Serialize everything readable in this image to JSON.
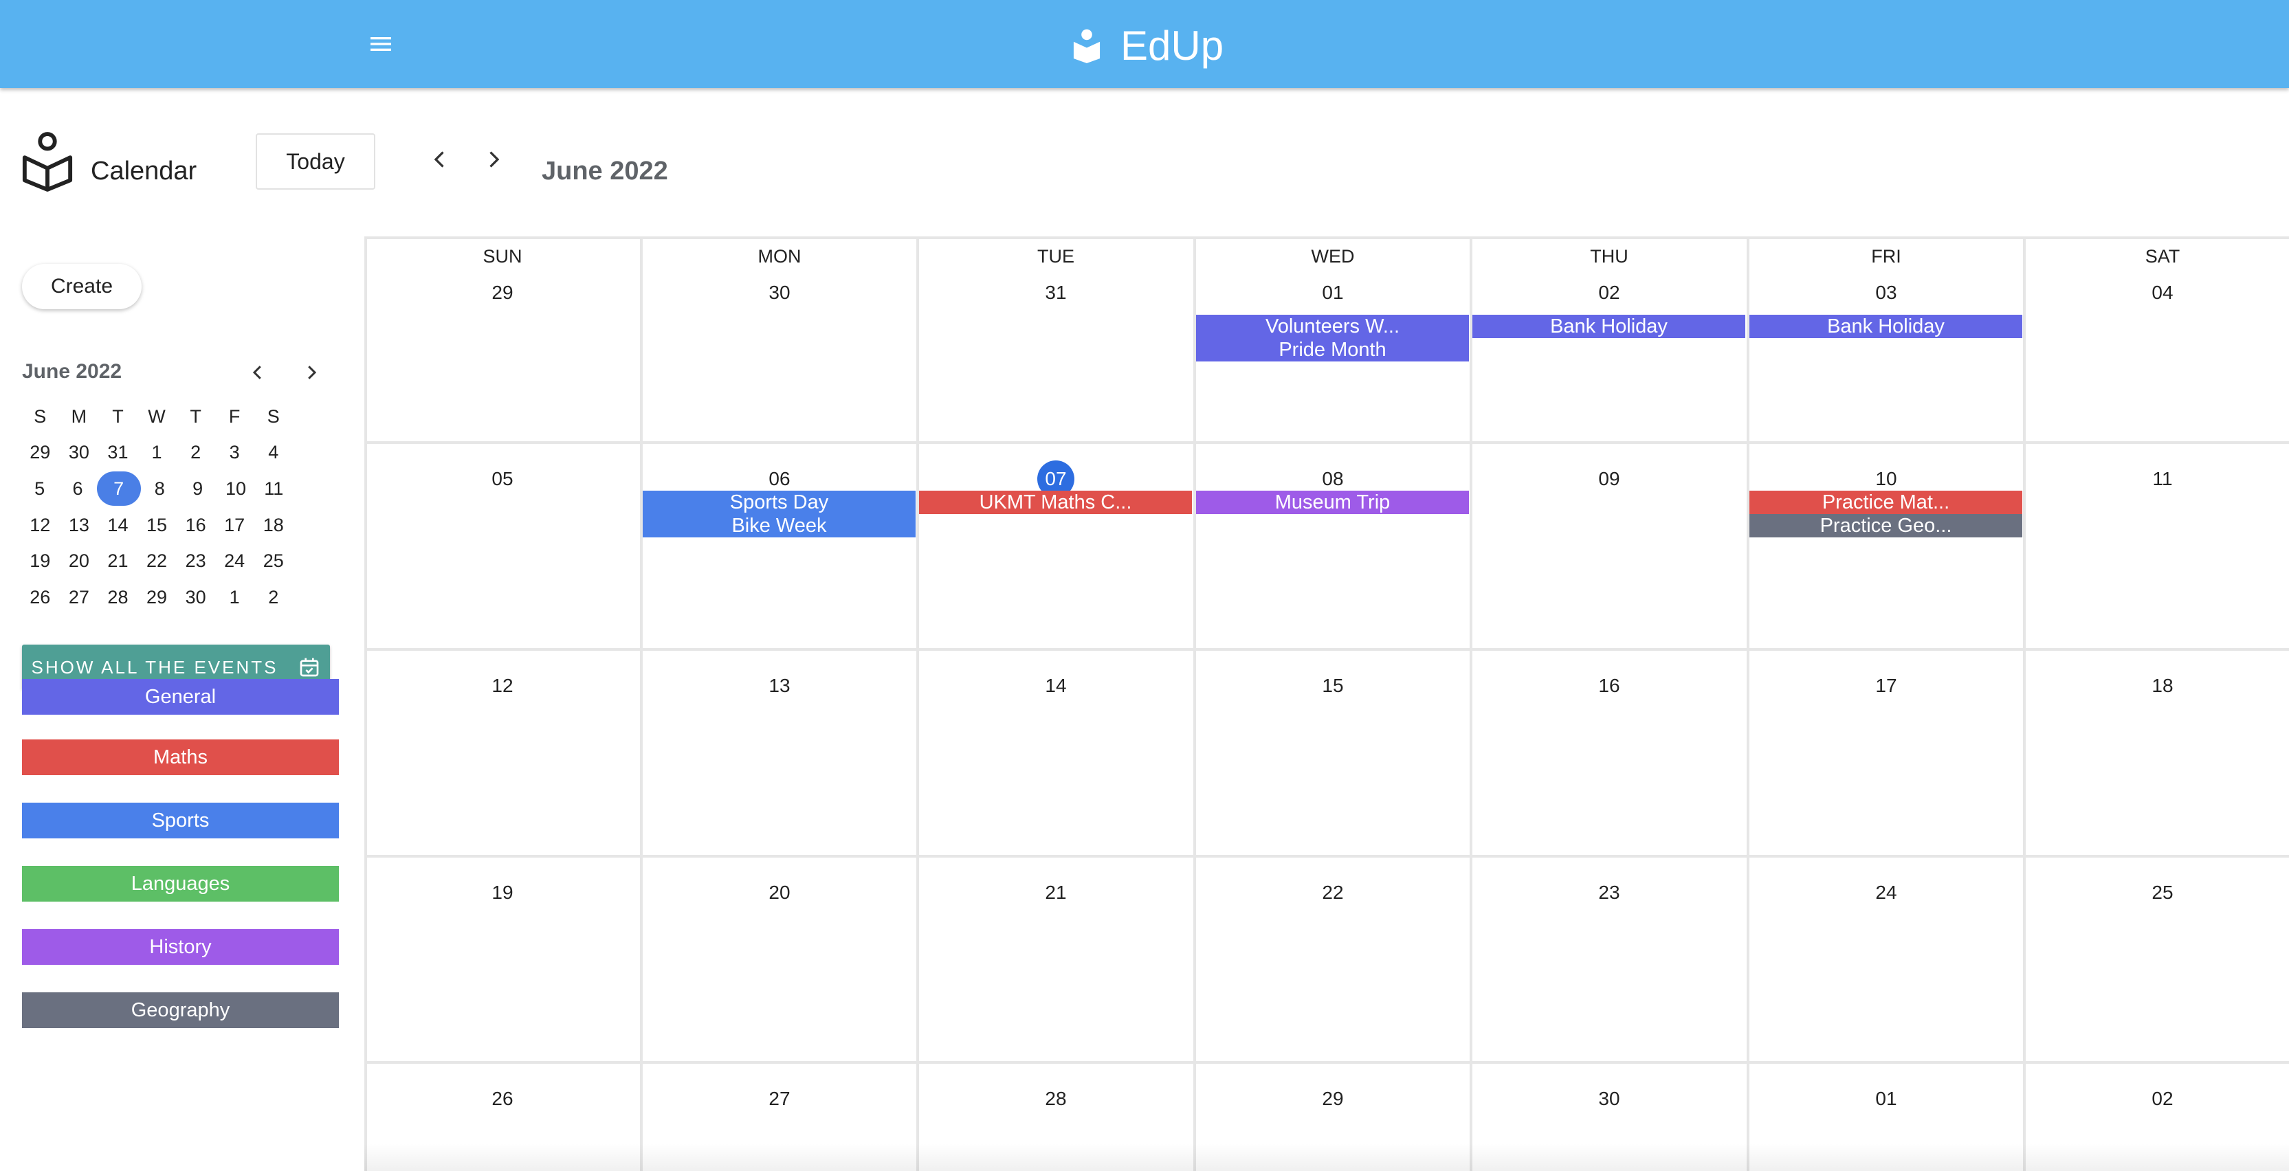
{
  "app": {
    "name": "EdUp"
  },
  "header": {
    "title": "Calendar",
    "today_label": "Today",
    "month_label": "June 2022"
  },
  "sidebar": {
    "create_label": "Create",
    "mini_calendar": {
      "title": "June 2022",
      "weekdays": [
        "S",
        "M",
        "T",
        "W",
        "T",
        "F",
        "S"
      ],
      "weeks": [
        [
          "29",
          "30",
          "31",
          "1",
          "2",
          "3",
          "4"
        ],
        [
          "5",
          "6",
          "7",
          "8",
          "9",
          "10",
          "11"
        ],
        [
          "12",
          "13",
          "14",
          "15",
          "16",
          "17",
          "18"
        ],
        [
          "19",
          "20",
          "21",
          "22",
          "23",
          "24",
          "25"
        ],
        [
          "26",
          "27",
          "28",
          "29",
          "30",
          "1",
          "2"
        ]
      ],
      "selected": "7"
    },
    "show_all_label": "SHOW ALL THE EVENTS",
    "categories": [
      {
        "label": "General",
        "color": "#6366e6"
      },
      {
        "label": "Maths",
        "color": "#e0504b"
      },
      {
        "label": "Sports",
        "color": "#4a80ea"
      },
      {
        "label": "Languages",
        "color": "#5dbf66"
      },
      {
        "label": "History",
        "color": "#9e5be8"
      },
      {
        "label": "Geography",
        "color": "#6a7080"
      }
    ]
  },
  "calendar": {
    "weekdays": [
      "SUN",
      "MON",
      "TUE",
      "WED",
      "THU",
      "FRI",
      "SAT"
    ],
    "weeks": [
      [
        "29",
        "30",
        "31",
        "01",
        "02",
        "03",
        "04"
      ],
      [
        "05",
        "06",
        "07",
        "08",
        "09",
        "10",
        "11"
      ],
      [
        "12",
        "13",
        "14",
        "15",
        "16",
        "17",
        "18"
      ],
      [
        "19",
        "20",
        "21",
        "22",
        "23",
        "24",
        "25"
      ],
      [
        "26",
        "27",
        "28",
        "29",
        "30",
        "01",
        "02"
      ]
    ],
    "today": "07",
    "events": [
      {
        "week": 0,
        "day": 3,
        "slot": 0,
        "label": "Volunteers W...",
        "color": "#6366e6"
      },
      {
        "week": 0,
        "day": 3,
        "slot": 1,
        "label": "Pride Month",
        "color": "#6366e6"
      },
      {
        "week": 0,
        "day": 4,
        "slot": 0,
        "label": "Bank Holiday",
        "color": "#6366e6"
      },
      {
        "week": 0,
        "day": 5,
        "slot": 0,
        "label": "Bank Holiday",
        "color": "#6366e6"
      },
      {
        "week": 1,
        "day": 1,
        "slot": 0,
        "label": "Sports Day",
        "color": "#4a80ea"
      },
      {
        "week": 1,
        "day": 1,
        "slot": 1,
        "label": "Bike Week",
        "color": "#4a80ea"
      },
      {
        "week": 1,
        "day": 2,
        "slot": 0,
        "label": "UKMT Maths C...",
        "color": "#e0504b"
      },
      {
        "week": 1,
        "day": 3,
        "slot": 0,
        "label": "Museum Trip",
        "color": "#9e5be8"
      },
      {
        "week": 1,
        "day": 5,
        "slot": 0,
        "label": "Practice Mat...",
        "color": "#e0504b"
      },
      {
        "week": 1,
        "day": 5,
        "slot": 1,
        "label": "Practice Geo...",
        "color": "#6a7080"
      }
    ]
  }
}
